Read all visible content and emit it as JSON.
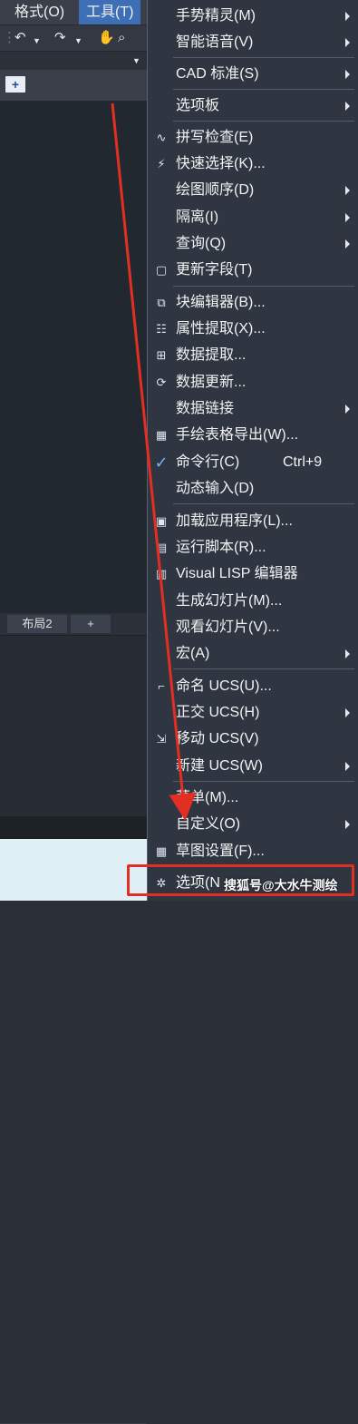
{
  "menubar": {
    "items": [
      "格式(O)",
      "工具(T)"
    ]
  },
  "toolbar": {
    "icons": [
      "undo-icon",
      "redo-icon",
      "pan-hand-icon",
      "zoom-icon"
    ]
  },
  "tabs": {
    "new_tab": "+"
  },
  "layout_tabs": [
    "布局2",
    "+"
  ],
  "menu": {
    "items": [
      {
        "label": "手势精灵(M)",
        "submenu": true,
        "icon": ""
      },
      {
        "label": "智能语音(V)",
        "submenu": true,
        "icon": ""
      },
      {
        "label": "CAD 标准(S)",
        "submenu": true,
        "icon": ""
      },
      {
        "label": "选项板",
        "submenu": true,
        "icon": ""
      },
      {
        "label": "拼写检查(E)",
        "submenu": false,
        "icon": "spell-check-icon"
      },
      {
        "label": "快速选择(K)...",
        "submenu": false,
        "icon": "quick-select-icon"
      },
      {
        "label": "绘图顺序(D)",
        "submenu": true,
        "icon": ""
      },
      {
        "label": "隔离(I)",
        "submenu": true,
        "icon": ""
      },
      {
        "label": "查询(Q)",
        "submenu": true,
        "icon": ""
      },
      {
        "label": "更新字段(T)",
        "submenu": false,
        "icon": "update-field-icon"
      },
      {
        "label": "块编辑器(B)...",
        "submenu": false,
        "icon": "block-editor-icon"
      },
      {
        "label": "属性提取(X)...",
        "submenu": false,
        "icon": "attribute-extract-icon"
      },
      {
        "label": "数据提取...",
        "submenu": false,
        "icon": "data-extract-icon"
      },
      {
        "label": "数据更新...",
        "submenu": false,
        "icon": "data-update-icon"
      },
      {
        "label": "数据链接",
        "submenu": true,
        "icon": ""
      },
      {
        "label": "手绘表格导出(W)...",
        "submenu": false,
        "icon": "table-export-icon"
      },
      {
        "label": "命令行(C)",
        "shortcut": "Ctrl+9",
        "submenu": false,
        "icon": "checkmark-icon"
      },
      {
        "label": "动态输入(D)",
        "submenu": false,
        "icon": ""
      },
      {
        "label": "加载应用程序(L)...",
        "submenu": false,
        "icon": "load-app-icon"
      },
      {
        "label": "运行脚本(R)...",
        "submenu": false,
        "icon": "run-script-icon"
      },
      {
        "label": "Visual LISP 编辑器",
        "submenu": false,
        "icon": "lisp-editor-icon"
      },
      {
        "label": "生成幻灯片(M)...",
        "submenu": false,
        "icon": ""
      },
      {
        "label": "观看幻灯片(V)...",
        "submenu": false,
        "icon": ""
      },
      {
        "label": "宏(A)",
        "submenu": true,
        "icon": ""
      },
      {
        "label": "命名 UCS(U)...",
        "submenu": false,
        "icon": "named-ucs-icon"
      },
      {
        "label": "正交 UCS(H)",
        "submenu": true,
        "icon": ""
      },
      {
        "label": "移动 UCS(V)",
        "submenu": false,
        "icon": "move-ucs-icon"
      },
      {
        "label": "新建 UCS(W)",
        "submenu": true,
        "icon": ""
      },
      {
        "label": "菜单(M)...",
        "submenu": false,
        "icon": ""
      },
      {
        "label": "自定义(O)",
        "submenu": true,
        "icon": ""
      },
      {
        "label": "草图设置(F)...",
        "submenu": false,
        "icon": "drafting-settings-icon"
      },
      {
        "label": "选项(N",
        "submenu": false,
        "icon": "options-gear-icon"
      }
    ]
  },
  "watermark": "搜狐号@大水牛测绘",
  "colors": {
    "menu_bg": "#2f3541",
    "active_menu": "#3d6fb6",
    "annotation_red": "#e32e22"
  }
}
